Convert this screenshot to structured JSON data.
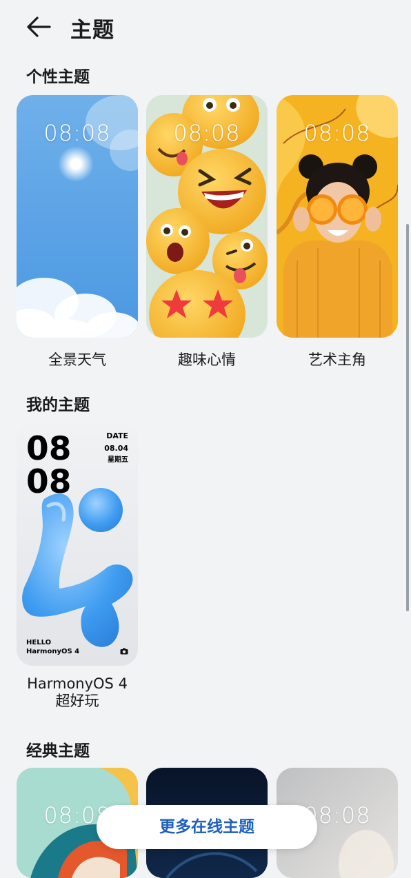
{
  "header": {
    "title": "主题"
  },
  "sections": {
    "personal": "个性主题",
    "mine": "我的主题",
    "classic": "经典主题"
  },
  "personal_themes": [
    {
      "label": "全景天气",
      "clock": "08:08"
    },
    {
      "label": "趣味心情",
      "clock": "08:08"
    },
    {
      "label": "艺术主角",
      "clock": "08:08"
    }
  ],
  "my_themes": [
    {
      "label_line1": "HarmonyOS 4",
      "label_line2": "超好玩",
      "hour": "08",
      "minute": "08",
      "date_title": "DATE",
      "date_value": "08.04",
      "weekday": "星期五",
      "hello": "HELLO",
      "brand": "HarmonyOS 4"
    }
  ],
  "classic_themes": [
    {
      "clock": "08:08"
    },
    {
      "clock": ""
    },
    {
      "clock": "08:08"
    }
  ],
  "more_button": "更多在线主题",
  "colors": {
    "accent": "#1f5fbf",
    "background": "#f1f3f5"
  }
}
